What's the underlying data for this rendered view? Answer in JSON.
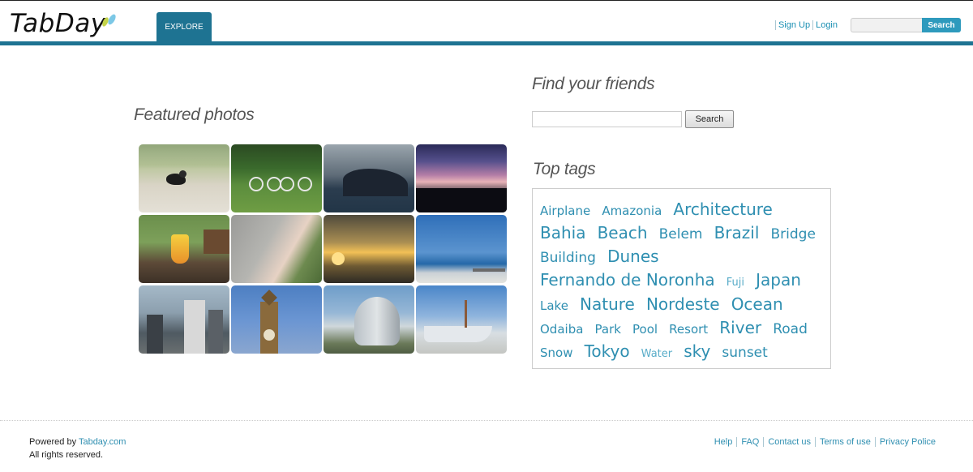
{
  "header": {
    "logo": "TabDay",
    "explore_tab": "EXPLORE",
    "links": [
      "Sign Up",
      "Login"
    ],
    "search_placeholder": "",
    "search_button": "Search",
    "accent_color": "#1e7392"
  },
  "featured": {
    "title": "Featured photos",
    "photos": [
      "bird-photo",
      "bicycles-photo",
      "island-photo",
      "sunset-lake-photo",
      "cocktail-photo",
      "beach-aerial-photo",
      "bridge-sunset-photo",
      "pier-sea-photo",
      "city-skyline-photo",
      "big-ben-photo",
      "city-hall-photo",
      "boat-photo"
    ]
  },
  "friends": {
    "title": "Find your friends",
    "input_value": "",
    "search_button": "Search"
  },
  "tags": {
    "title": "Top tags",
    "items": [
      {
        "label": "Airplane",
        "size": 2
      },
      {
        "label": "Amazonia",
        "size": 2
      },
      {
        "label": "Architecture",
        "size": 4
      },
      {
        "label": "Bahia",
        "size": 4
      },
      {
        "label": "Beach",
        "size": 4
      },
      {
        "label": "Belem",
        "size": 3
      },
      {
        "label": "Brazil",
        "size": 4
      },
      {
        "label": "Bridge",
        "size": 3
      },
      {
        "label": "Building",
        "size": 3
      },
      {
        "label": "Dunes",
        "size": 4
      },
      {
        "label": "Fernando de Noronha",
        "size": 4
      },
      {
        "label": "Fuji",
        "size": 1
      },
      {
        "label": "Japan",
        "size": 4
      },
      {
        "label": "Lake",
        "size": 2
      },
      {
        "label": "Nature",
        "size": 4
      },
      {
        "label": "Nordeste",
        "size": 4
      },
      {
        "label": "Ocean",
        "size": 4
      },
      {
        "label": "Odaiba",
        "size": 2
      },
      {
        "label": "Park",
        "size": 2
      },
      {
        "label": "Pool",
        "size": 2
      },
      {
        "label": "Resort",
        "size": 2
      },
      {
        "label": "River",
        "size": 4
      },
      {
        "label": "Road",
        "size": 3
      },
      {
        "label": "Snow",
        "size": 2
      },
      {
        "label": "Tokyo",
        "size": 4
      },
      {
        "label": "Water",
        "size": 1
      },
      {
        "label": "sky",
        "size": 4
      },
      {
        "label": "sunset",
        "size": 3
      }
    ]
  },
  "footer": {
    "powered_by": "Powered by",
    "powered_link": "Tabday.com",
    "rights": "All rights reserved.",
    "links": [
      "Help",
      "FAQ",
      "Contact us",
      "Terms of use",
      "Privacy Police"
    ]
  }
}
